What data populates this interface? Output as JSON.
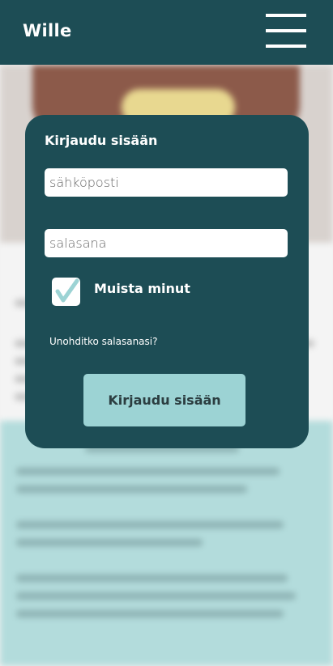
{
  "header": {
    "brand": "Wille",
    "menu_icon": "hamburger-menu-icon"
  },
  "login": {
    "title": "Kirjaudu sisään",
    "email_placeholder": "sähköposti",
    "password_placeholder": "salasana",
    "remember_label": "Muista minut",
    "remember_checked": true,
    "forgot_link": "Unohditko salasanasi?",
    "submit_label": "Kirjaudu sisään"
  },
  "colors": {
    "header_bg": "#1d4d55",
    "card_bg": "#1d4d55",
    "button_bg": "#9cd3d4",
    "checkmark": "#9cd3d4",
    "lower_section_bg": "#b3dcdc"
  }
}
